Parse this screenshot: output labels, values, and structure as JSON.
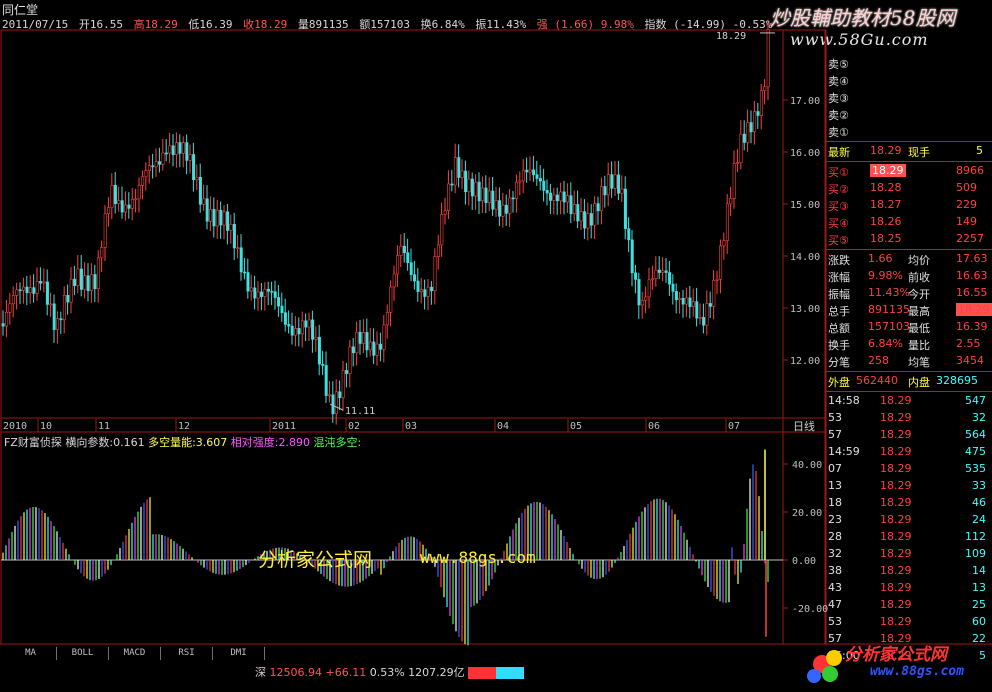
{
  "title": "同仁堂",
  "infobar": {
    "date": "2011/07/15",
    "open": "开16.55",
    "high": "高18.29",
    "low": "低16.39",
    "close": "收18.29",
    "vol": "量891135",
    "amount": "额157103",
    "turnover": "换6.84%",
    "amplitude": "振11.43%",
    "strength": "强 (1.66) 9.98%",
    "index": "指数 (-14.99) -0.53%"
  },
  "brand": {
    "line1": "炒股輔助教材58股网",
    "line2": "www.58Gu.com"
  },
  "price_chart": {
    "high_label": "18.29",
    "low_label": "11.11",
    "y_labels": [
      "17.00",
      "16.00",
      "15.00",
      "14.00",
      "13.00",
      "12.00"
    ],
    "month_labels": [
      "2010",
      "10",
      "11",
      "12",
      "2011",
      "02",
      "03",
      "04",
      "05",
      "06",
      "07"
    ],
    "period": "日线"
  },
  "indicator": {
    "name": "FZ财富侦探",
    "p1": "横向参数:0.161",
    "p2": "多空量能:3.607",
    "p3": "相对强度:2.890",
    "p4": "混沌多空:",
    "y_labels": [
      "40.00",
      "20.00",
      "0.00",
      "-20.00"
    ]
  },
  "watermark": {
    "cn": "分析家公式网",
    "url": "www.88gs.com"
  },
  "tabs": [
    "MA",
    "BOLL",
    "MACD",
    "RSI",
    "DMI"
  ],
  "status": {
    "market": "深",
    "index": "12506.94",
    "change": "+66.11",
    "pct": "0.53%",
    "amount": "1207.29亿"
  },
  "logo": {
    "cn": "分析家公式网",
    "url": "www.88gs.com"
  },
  "panel": {
    "sells": [
      {
        "label": "卖⑤"
      },
      {
        "label": "卖④"
      },
      {
        "label": "卖③"
      },
      {
        "label": "卖②"
      },
      {
        "label": "卖①"
      }
    ],
    "latest": {
      "label": "最新",
      "price": "18.29",
      "hand_label": "现手",
      "hand": "5"
    },
    "buys": [
      {
        "label": "买①",
        "price": "18.29",
        "vol": "8966"
      },
      {
        "label": "买②",
        "price": "18.28",
        "vol": "509"
      },
      {
        "label": "买③",
        "price": "18.27",
        "vol": "229"
      },
      {
        "label": "买④",
        "price": "18.26",
        "vol": "149"
      },
      {
        "label": "买⑤",
        "price": "18.25",
        "vol": "2257"
      }
    ],
    "stats": [
      {
        "k1": "涨跌",
        "v1": "1.66",
        "k2": "均价",
        "v2": "17.63"
      },
      {
        "k1": "涨幅",
        "v1": "9.98%",
        "k2": "前收",
        "v2": "16.63"
      },
      {
        "k1": "振幅",
        "v1": "11.43%",
        "k2": "今开",
        "v2": "16.55"
      },
      {
        "k1": "总手",
        "v1": "891135",
        "k2": "最高",
        "v2": "18.29"
      },
      {
        "k1": "总额",
        "v1": "157103",
        "k2": "最低",
        "v2": "16.39"
      },
      {
        "k1": "换手",
        "v1": "6.84%",
        "k2": "量比",
        "v2": "2.55"
      },
      {
        "k1": "分笔",
        "v1": "258",
        "k2": "均笔",
        "v2": "3454"
      }
    ],
    "outer": {
      "k1": "外盘",
      "v1": "562440",
      "k2": "内盘",
      "v2": "328695"
    },
    "ticks": [
      {
        "t": "14:58",
        "p": "18.29",
        "v": "547"
      },
      {
        "t": "53",
        "p": "18.29",
        "v": "32"
      },
      {
        "t": "57",
        "p": "18.29",
        "v": "564"
      },
      {
        "t": "14:59",
        "p": "18.29",
        "v": "475"
      },
      {
        "t": "07",
        "p": "18.29",
        "v": "535"
      },
      {
        "t": "13",
        "p": "18.29",
        "v": "33"
      },
      {
        "t": "18",
        "p": "18.29",
        "v": "46"
      },
      {
        "t": "23",
        "p": "18.29",
        "v": "24"
      },
      {
        "t": "28",
        "p": "18.29",
        "v": "112"
      },
      {
        "t": "32",
        "p": "18.29",
        "v": "109"
      },
      {
        "t": "38",
        "p": "18.29",
        "v": "14"
      },
      {
        "t": "43",
        "p": "18.29",
        "v": "13"
      },
      {
        "t": "47",
        "p": "18.29",
        "v": "25"
      },
      {
        "t": "53",
        "p": "18.29",
        "v": "60"
      },
      {
        "t": "57",
        "p": "18.29",
        "v": "22"
      },
      {
        "t": "15:00",
        "p": "18.29",
        "v": "5"
      }
    ]
  }
}
